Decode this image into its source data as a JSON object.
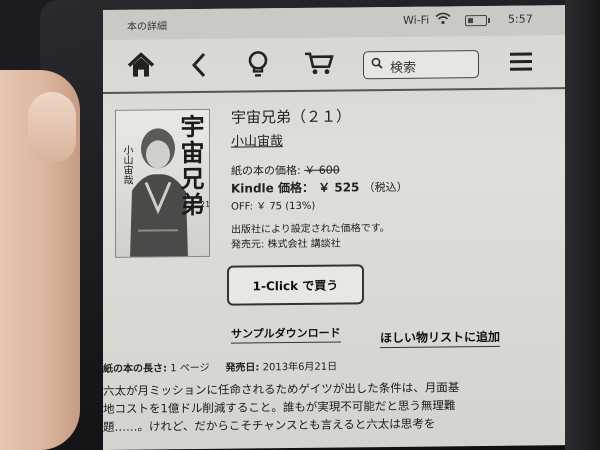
{
  "status_bar": {
    "title": "本の詳細",
    "wifi": "Wi-Fi",
    "time": "5:57"
  },
  "toolbar": {
    "icons": [
      "home-icon",
      "back-icon",
      "lightbulb-icon",
      "cart-icon",
      "menu-icon"
    ],
    "search_placeholder": "検索"
  },
  "book": {
    "cover_title": "宇宙兄弟",
    "cover_author": "小山宙哉",
    "cover_volume": "21",
    "title": "宇宙兄弟（２１）",
    "author": "小山宙哉",
    "print_price_label": "紙の本の価格:",
    "print_price": "￥ 600",
    "kindle_price_label": "Kindle 価格：",
    "kindle_price": "￥ 525",
    "tax_note": "（税込）",
    "off": "OFF: ￥ 75 (13%)",
    "publisher_note": "出版社により設定された価格です。",
    "seller": "発売元: 株式会社 講談社"
  },
  "actions": {
    "buy_label": "1-Click で買う",
    "sample_label": "サンプルダウンロード",
    "wishlist_label": "ほしい物リストに追加"
  },
  "meta": {
    "length_label": "紙の本の長さ:",
    "length_value": "1 ページ",
    "release_label": "発売日:",
    "release_value": "2013年6月21日"
  },
  "description": {
    "lines": [
      "六太が月ミッションに任命されるためゲイツが出した条件は、月面基",
      "地コストを1億ドル削減すること。誰もが実現不可能だと思う無理難",
      "題……。けれど、だからこそチャンスとも言えると六太は思考を"
    ]
  },
  "colors": {
    "screen": "#d9d9d5",
    "ink": "#222222",
    "bezel": "#1c1c20"
  }
}
